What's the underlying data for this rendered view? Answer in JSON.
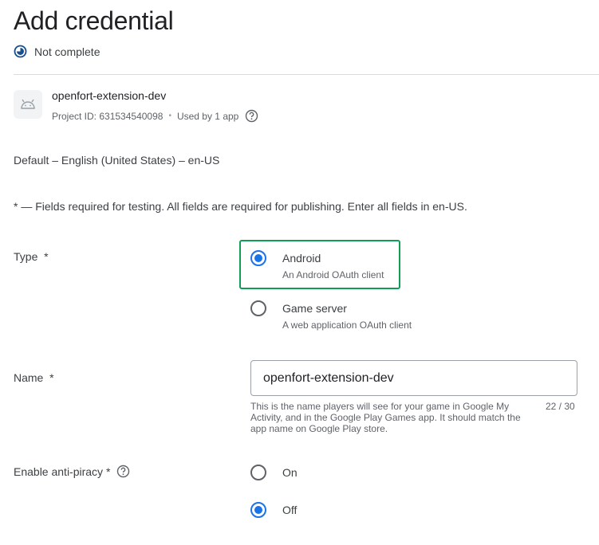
{
  "page": {
    "title": "Add credential",
    "status": "Not complete"
  },
  "app": {
    "name": "openfort-extension-dev",
    "project_id": "Project ID: 631534540098",
    "separator": "•",
    "used_by": "Used by 1 app"
  },
  "locale": "Default – English (United States) – en-US",
  "required_note": "* — Fields required for testing. All fields are required for publishing. Enter all fields in en-US.",
  "type_field": {
    "label": "Type  *",
    "options": [
      {
        "title": "Android",
        "subtitle": "An Android OAuth client",
        "selected": true
      },
      {
        "title": "Game server",
        "subtitle": "A web application OAuth client",
        "selected": false
      }
    ]
  },
  "name_field": {
    "label": "Name  *",
    "value": "openfort-extension-dev",
    "helper": "This is the name players will see for your game in Google My Activity, and in the Google Play Games app. It should match the app name on Google Play store.",
    "counter": "22 / 30"
  },
  "anti_piracy": {
    "label": "Enable anti-piracy *",
    "options": [
      {
        "title": "On",
        "selected": false
      },
      {
        "title": "Off",
        "selected": true
      }
    ]
  },
  "colors": {
    "accent": "#1a73e8",
    "highlight": "#0f9d58",
    "divider": "#dadce0"
  }
}
